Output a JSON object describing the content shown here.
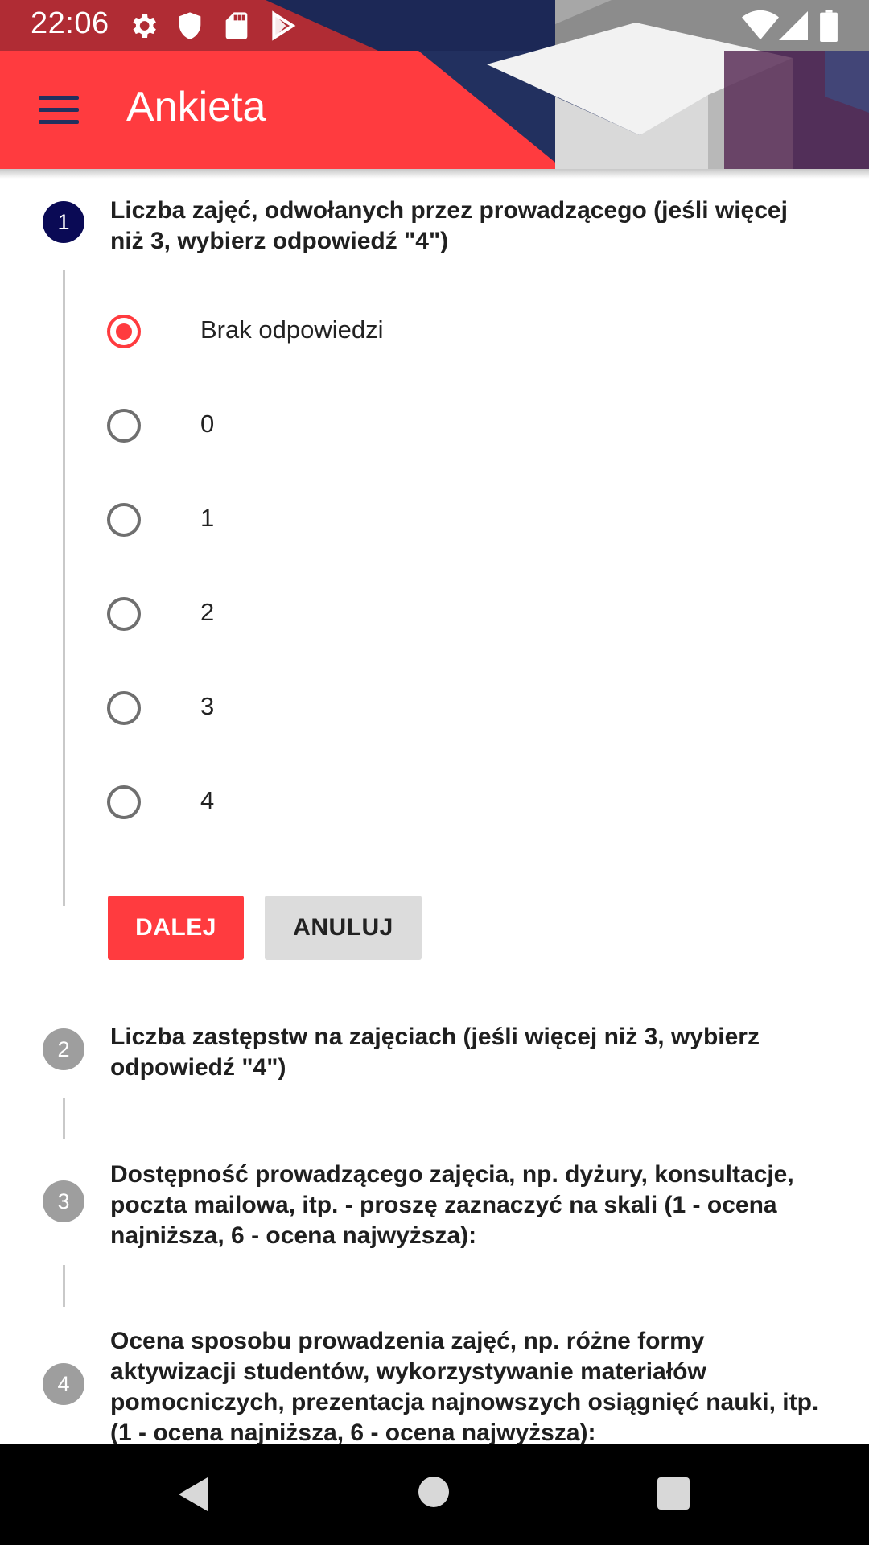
{
  "status_bar": {
    "time": "22:06",
    "icons": [
      "settings-icon",
      "shield-icon",
      "sd-card-icon",
      "play-store-icon",
      "wifi-icon",
      "signal-icon",
      "battery-icon"
    ]
  },
  "toolbar": {
    "title": "Ankieta",
    "menu_icon": "hamburger-menu-icon"
  },
  "colors": {
    "accent": "#ff3b3f",
    "active_step": "#0a0a55",
    "inactive_step": "#9e9e9e",
    "cancel_button": "#dcdcdc"
  },
  "steps": [
    {
      "number": "1",
      "title": "Liczba zajęć, odwołanych przez prowadzącego (jeśli więcej niż 3, wybierz odpowiedź \"4\")",
      "options": [
        "Brak odpowiedzi",
        "0",
        "1",
        "2",
        "3",
        "4"
      ],
      "selected": "Brak odpowiedzi",
      "next_label": "DALEJ",
      "cancel_label": "ANULUJ"
    },
    {
      "number": "2",
      "title": "Liczba zastępstw na zajęciach (jeśli więcej niż 3, wybierz odpowiedź \"4\")"
    },
    {
      "number": "3",
      "title": "Dostępność prowadzącego zajęcia, np. dyżury, konsultacje, poczta mailowa, itp. - proszę zaznaczyć na skali (1 - ocena najniższa, 6 - ocena najwyższa):"
    },
    {
      "number": "4",
      "title": "Ocena sposobu prowadzenia zajęć, np. różne formy aktywizacji studentów, wykorzystywanie materiałów pomocniczych, prezentacja najnowszych osiągnięć nauki, itp. (1 - ocena najniższa, 6 - ocena najwyższa):"
    }
  ],
  "nav_bar": {
    "icons": [
      "back-icon",
      "home-icon",
      "recents-icon"
    ]
  }
}
